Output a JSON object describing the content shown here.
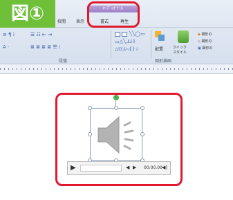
{
  "badge": {
    "label": "図①"
  },
  "tabs": [
    {
      "label": "校閲"
    },
    {
      "label": "表示"
    },
    {
      "label": "書式"
    },
    {
      "label": "再生"
    }
  ],
  "contextual_group": {
    "label": "ｵｰﾃﾞｨｵ ﾂｰﾙ"
  },
  "ribbon": {
    "group_paragraph": {
      "label": "段落"
    },
    "group_drawing": {
      "label": "図形描画"
    },
    "arrange": {
      "label": "配置"
    },
    "quick_style": {
      "label_line1": "クイック",
      "label_line2": "スタイル"
    },
    "shape_fill": {
      "label": "図形の"
    },
    "shape_outline": {
      "label": "図形の"
    },
    "shape_effect": {
      "label": "図形の"
    }
  },
  "player": {
    "time": "00:00.00"
  },
  "colors": {
    "badge": "#6fbf39",
    "highlight": "#e0192f",
    "context_tab": "#9d80c8"
  }
}
